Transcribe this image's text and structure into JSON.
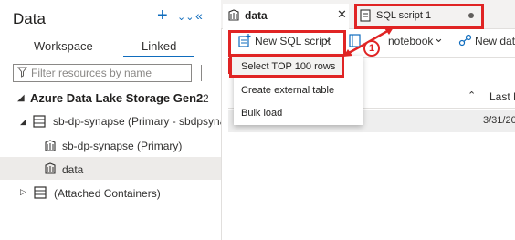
{
  "left": {
    "title": "Data",
    "tabs": [
      "Workspace",
      "Linked"
    ],
    "filter_placeholder": "Filter resources by name",
    "group": {
      "label": "Azure Data Lake Storage Gen2",
      "count": "2"
    },
    "items": [
      "sb-dp-synapse (Primary - sbdpsyna...",
      "sb-dp-synapse (Primary)",
      "data",
      "(Attached Containers)"
    ]
  },
  "right": {
    "tab_data": "data",
    "tab_sql": "SQL script 1",
    "toolbar": {
      "new_sql": "New SQL script",
      "notebook": "notebook",
      "new_data": "New data"
    },
    "menu": [
      "Select TOP 100 rows",
      "Create external table",
      "Bulk load"
    ],
    "grid": {
      "last_modified": "Last M",
      "cell_date": "3/31/20"
    },
    "callout": "1"
  },
  "colors": {
    "accent": "#0f6cbd",
    "highlight": "#e02424",
    "selected_row": "#edebe9"
  }
}
